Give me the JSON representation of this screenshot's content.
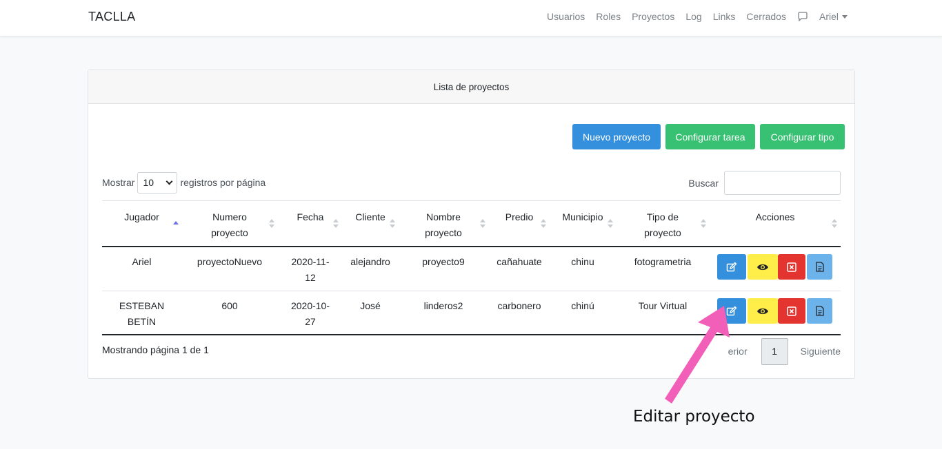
{
  "brand": "TACLLA",
  "nav": {
    "items": [
      "Usuarios",
      "Roles",
      "Proyectos",
      "Log",
      "Links",
      "Cerrados"
    ],
    "chat_icon": "chat-icon",
    "user": "Ariel"
  },
  "card": {
    "title": "Lista de proyectos",
    "buttons": {
      "new": "Nuevo proyecto",
      "config_task": "Configurar tarea",
      "config_type": "Configurar tipo"
    },
    "show_prefix": "Mostrar",
    "page_size": "10",
    "show_suffix": "registros por página",
    "search_label": "Buscar",
    "search_value": ""
  },
  "table": {
    "headers": {
      "jugador": "Jugador",
      "numero_1": "Numero",
      "numero_2": "proyecto",
      "fecha": "Fecha",
      "cliente": "Cliente",
      "nombre_1": "Nombre",
      "nombre_2": "proyecto",
      "predio": "Predio",
      "municipio": "Municipio",
      "tipo_1": "Tipo de",
      "tipo_2": "proyecto",
      "acciones": "Acciones"
    },
    "rows": [
      {
        "jugador_1": "Ariel",
        "jugador_2": "",
        "numero": "proyectoNuevo",
        "fecha_1": "2020-11-",
        "fecha_2": "12",
        "cliente": "alejandro",
        "nombre": "proyecto9",
        "predio": "cañahuate",
        "municipio": "chinu",
        "tipo": "fotogrametria"
      },
      {
        "jugador_1": "ESTEBAN",
        "jugador_2": "BETÍN",
        "numero": "600",
        "fecha_1": "2020-10-",
        "fecha_2": "27",
        "cliente": "José",
        "nombre": "linderos2",
        "predio": "carbonero",
        "municipio": "chinú",
        "tipo": "Tour Virtual"
      }
    ]
  },
  "footer": {
    "info": "Mostrando página 1 de 1",
    "prev": "erior",
    "page": "1",
    "next": "Siguiente"
  },
  "annotation": "Editar proyecto",
  "colors": {
    "primary": "#3490dc",
    "success": "#38c172",
    "warning": "#ffed4a",
    "danger": "#e3342f",
    "info": "#6cb2eb",
    "arrow": "#f25fb8"
  }
}
